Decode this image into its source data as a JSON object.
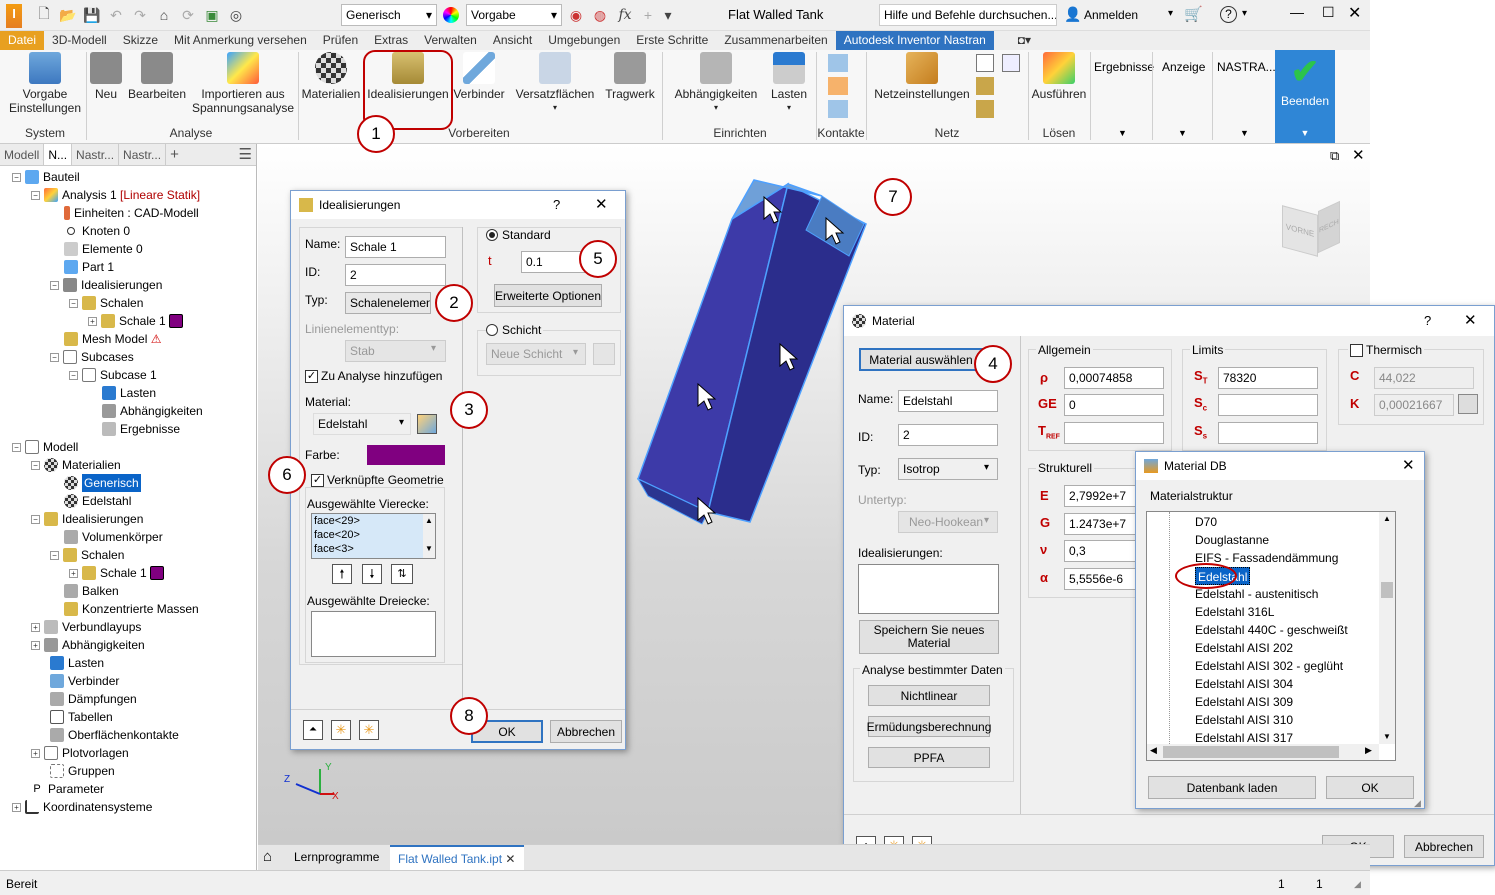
{
  "qat": {
    "material_combo": "Generisch",
    "appearance_combo": "Vorgabe",
    "title": "Flat Walled Tank",
    "help_search": "Hilfe und Befehle durchsuchen...",
    "signin": "Anmelden"
  },
  "menu": [
    "Datei",
    "3D-Modell",
    "Skizze",
    "Mit Anmerkung versehen",
    "Prüfen",
    "Extras",
    "Verwalten",
    "Ansicht",
    "Umgebungen",
    "Erste Schritte",
    "Zusammenarbeiten",
    "Autodesk Inventor Nastran"
  ],
  "ribbon": {
    "vorgabe": "Vorgabe",
    "einstellungen": "Einstellungen",
    "neu": "Neu",
    "bearbeiten": "Bearbeiten",
    "importieren": "Importieren aus",
    "spannungsanalyse": "Spannungsanalyse",
    "materialien": "Materialien",
    "idealisierungen": "Idealisierungen",
    "verbinder": "Verbinder",
    "versatzflaechen": "Versatzflächen",
    "tragwerk": "Tragwerk",
    "abhaengigkeiten": "Abhängigkeiten",
    "lasten": "Lasten",
    "netzeinstellungen": "Netzeinstellungen",
    "ausfuehren": "Ausführen",
    "ergebnisse": "Ergebnisse",
    "anzeige": "Anzeige",
    "nastra": "NASTRA...",
    "beenden": "Beenden",
    "groups": {
      "system": "System",
      "analyse": "Analyse",
      "vorbereiten": "Vorbereiten",
      "einrichten": "Einrichten",
      "kontakte": "Kontakte",
      "netz": "Netz",
      "loesen": "Lösen"
    }
  },
  "panel_tabs": [
    "Modell",
    "N...",
    "Nastr...",
    "Nastr..."
  ],
  "tree": {
    "bauteil": "Bauteil",
    "analysis": "Analysis 1",
    "analysis_type": "[Lineare Statik]",
    "einheiten": "Einheiten : CAD-Modell",
    "knoten": "Knoten 0",
    "elemente": "Elemente 0",
    "part": "Part 1",
    "idealisierungen": "Idealisierungen",
    "schalen": "Schalen",
    "schale1": "Schale 1",
    "mesh": "Mesh Model",
    "subcases": "Subcases",
    "subcase1": "Subcase 1",
    "lasten": "Lasten",
    "abhaengigkeiten": "Abhängigkeiten",
    "ergebnisse": "Ergebnisse",
    "modell": "Modell",
    "materialien": "Materialien",
    "generisch": "Generisch",
    "edelstahl": "Edelstahl",
    "idealisierungen2": "Idealisierungen",
    "volumenkoerper": "Volumenkörper",
    "schalen2": "Schalen",
    "schale1b": "Schale 1",
    "balken": "Balken",
    "konz_massen": "Konzentrierte Massen",
    "verbundlayups": "Verbundlayups",
    "abhaengigkeiten2": "Abhängigkeiten",
    "lasten2": "Lasten",
    "verbinder": "Verbinder",
    "daempfungen": "Dämpfungen",
    "tabellen": "Tabellen",
    "oberflaechenkontakte": "Oberflächenkontakte",
    "plotvorlagen": "Plotvorlagen",
    "gruppen": "Gruppen",
    "parameter": "Parameter",
    "koordinatensysteme": "Koordinatensysteme"
  },
  "ideal_dialog": {
    "title": "Idealisierungen",
    "help": "?",
    "name_label": "Name:",
    "name_value": "Schale 1",
    "id_label": "ID:",
    "id_value": "2",
    "typ_label": "Typ:",
    "typ_value": "Schalenelemente",
    "linien_label": "Linienelementtyp:",
    "linien_value": "Stab",
    "zu_analyse": "Zu Analyse hinzufügen",
    "material_label": "Material:",
    "material_value": "Edelstahl",
    "farbe_label": "Farbe:",
    "farbe_color": "#800080",
    "verknuepfte": "Verknüpfte Geometrie",
    "vierecke_label": "Ausgewählte Vierecke:",
    "faces": [
      "face<29>",
      "face<20>",
      "face<3>"
    ],
    "dreiecke_label": "Ausgewählte Dreiecke:",
    "standard": "Standard",
    "t_label": "t",
    "t_value": "0.1",
    "erweiterte": "Erweiterte Optionen",
    "schicht": "Schicht",
    "neue_schicht": "Neue Schicht",
    "ok": "OK",
    "abbrechen": "Abbrechen"
  },
  "material_dialog": {
    "title": "Material",
    "help": "?",
    "auswaehlen": "Material auswählen",
    "name_label": "Name:",
    "name_value": "Edelstahl",
    "id_label": "ID:",
    "id_value": "2",
    "typ_label": "Typ:",
    "typ_value": "Isotrop",
    "untertyp_label": "Untertyp:",
    "untertyp_value": "Neo-Hookean",
    "ideal_label": "Idealisierungen:",
    "speichern": "Speichern Sie neues Material",
    "analyse_label": "Analyse bestimmter Daten",
    "nichtlinear": "Nichtlinear",
    "ermuedung": "Ermüdungsberechnung",
    "ppfa": "PPFA",
    "allgemein": "Allgemein",
    "rho": "ρ",
    "rho_value": "0,00074858",
    "ge": "GE",
    "ge_value": "0",
    "tref": "T",
    "tref_sub": "REF",
    "strukturell": "Strukturell",
    "e": "E",
    "e_value": "2,7992e+7",
    "g": "G",
    "g_value": "1.2473e+7",
    "nu": "ν",
    "nu_value": "0,3",
    "alpha": "α",
    "alpha_value": "5,5556e-6",
    "limits": "Limits",
    "st": "S",
    "st_sub": "T",
    "st_value": "78320",
    "sc": "S",
    "sc_sub": "c",
    "ss": "S",
    "ss_sub": "s",
    "thermisch": "Thermisch",
    "c": "C",
    "c_value": "44,022",
    "k": "K",
    "k_value": "0,00021667",
    "ok": "OK",
    "abbrechen": "Abbrechen"
  },
  "material_db": {
    "title": "Material DB",
    "struktur": "Materialstruktur",
    "items": [
      "D70",
      "Douglastanne",
      "EIFS - Fassadendämmung",
      "Edelstahl",
      "Edelstahl - austenitisch",
      "Edelstahl 316L",
      "Edelstahl 440C - geschweißt",
      "Edelstahl AISI 202",
      "Edelstahl AISI 302 - geglüht",
      "Edelstahl AISI 304",
      "Edelstahl AISI 309",
      "Edelstahl AISI 310",
      "Edelstahl AISI 317"
    ],
    "selected_index": 3,
    "laden": "Datenbank laden",
    "ok": "OK"
  },
  "annotations": [
    "1",
    "2",
    "3",
    "4",
    "5",
    "6",
    "7",
    "8"
  ],
  "viewcube": {
    "front": "VORNE",
    "right": "RECHTS"
  },
  "doc_tabs": {
    "lern": "Lernprogramme",
    "file": "Flat Walled Tank.ipt",
    "close": "✕"
  },
  "status": {
    "text": "Bereit",
    "n1": "1",
    "n2": "1"
  }
}
